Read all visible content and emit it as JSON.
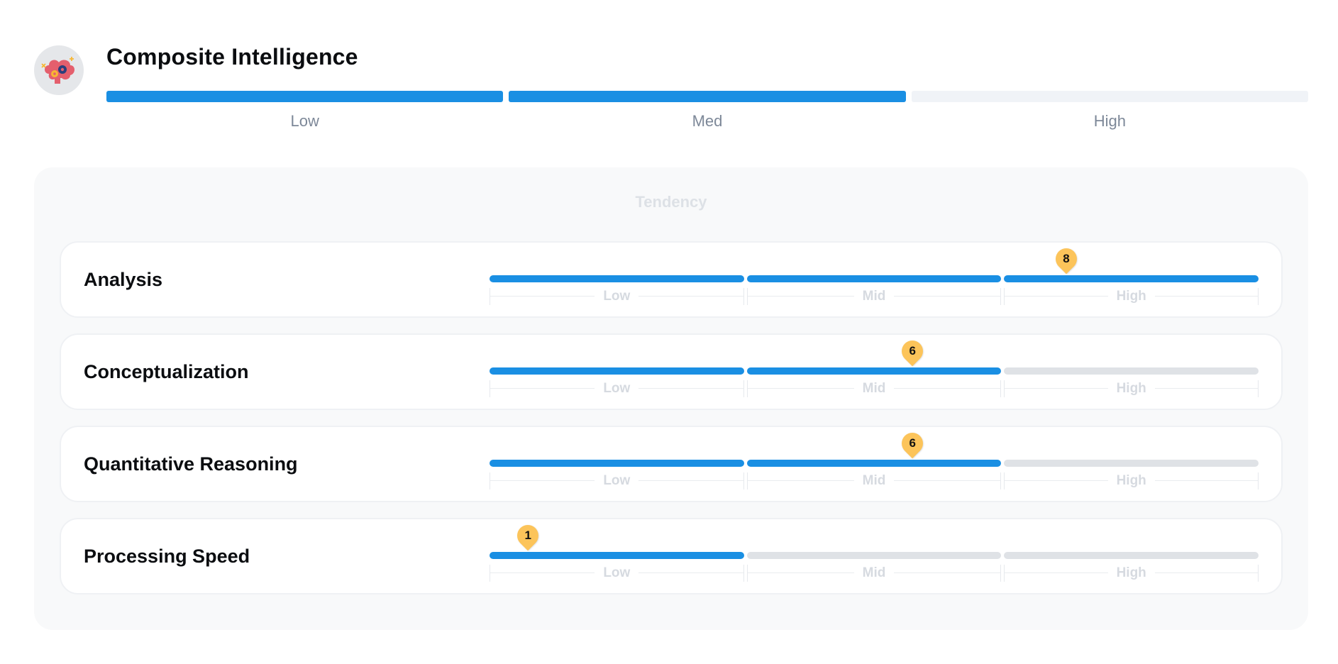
{
  "header": {
    "avatar_icon": "brain-gears-icon",
    "title": "Composite Intelligence",
    "level_filled_segments": 2,
    "levels": [
      "Low",
      "Med",
      "High"
    ]
  },
  "panel": {
    "title": "Tendency",
    "scale_labels": [
      "Low",
      "Mid",
      "High"
    ],
    "scale_max": 10,
    "rows": [
      {
        "label": "Analysis",
        "score": "8",
        "filled_segments": 3
      },
      {
        "label": "Conceptualization",
        "score": "6",
        "filled_segments": 2
      },
      {
        "label": "Quantitative Reasoning",
        "score": "6",
        "filled_segments": 2
      },
      {
        "label": "Processing Speed",
        "score": "1",
        "filled_segments": 1
      }
    ]
  },
  "colors": {
    "accent": "#1a8fe3",
    "marker": "#fcc45a",
    "track_empty": "#dfe2e6"
  }
}
